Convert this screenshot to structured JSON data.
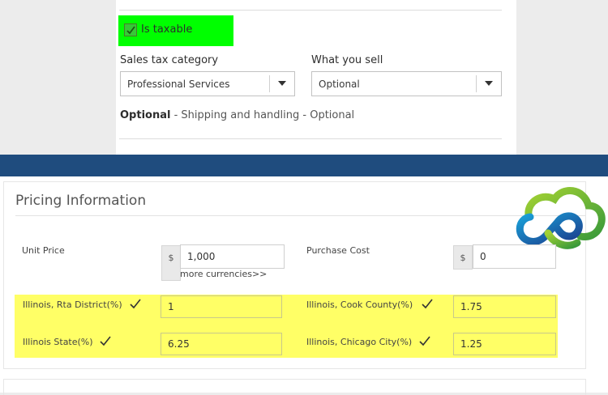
{
  "tax": {
    "taxable_label": "Is taxable",
    "taxable_checked": true,
    "sales_tax_category_label": "Sales tax category",
    "sales_tax_category_value": "Professional Services",
    "what_you_sell_label": "What you sell",
    "what_you_sell_value": "Optional",
    "shipping_bold": "Optional",
    "shipping_rest": " - Shipping and handling - Optional"
  },
  "pricing": {
    "title": "Pricing Information",
    "unit_price_label": "Unit Price",
    "unit_price_currency": "$",
    "unit_price_value": "1,000",
    "more_currencies_link": "more currencies>>",
    "purchase_cost_label": "Purchase Cost",
    "purchase_cost_currency": "$",
    "purchase_cost_value": "0"
  },
  "taxes": [
    {
      "label": "Illinois, Rta District(%)",
      "value": "1",
      "checked": true
    },
    {
      "label": "Illinois, Cook County(%)",
      "value": "1.75",
      "checked": true
    },
    {
      "label": "Illinois State(%)",
      "value": "6.25",
      "checked": true
    },
    {
      "label": "Illinois, Chicago City(%)",
      "value": "1.25",
      "checked": true
    }
  ],
  "colors": {
    "highlight_green": "#00ff00",
    "highlight_yellow": "#ffff66",
    "band_blue": "#1f4c7e"
  },
  "icons": {
    "logo": "cloud-loop-logo",
    "check": "check-icon",
    "dropdown": "caret-down-icon"
  }
}
